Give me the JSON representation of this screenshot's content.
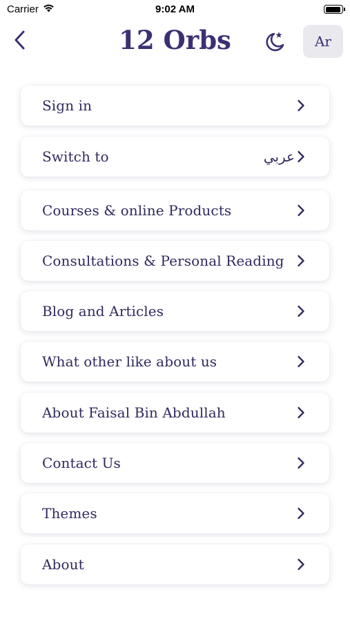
{
  "status_bar": {
    "carrier": "Carrier",
    "time": "9:02 AM",
    "battery_level": 0.95
  },
  "header": {
    "title": "12 Orbs",
    "back_icon": "chevron-left-icon",
    "theme_icon": "moon-star-icon",
    "language_button": "Ar"
  },
  "menu": {
    "items": [
      {
        "label": "Sign in",
        "value": ""
      },
      {
        "label": "Switch to",
        "value": "عربي"
      },
      {
        "label": "Courses & online Products",
        "value": ""
      },
      {
        "label": "Consultations & Personal Reading",
        "value": ""
      },
      {
        "label": "Blog and Articles",
        "value": ""
      },
      {
        "label": "What other like about us",
        "value": ""
      },
      {
        "label": "About Faisal Bin Abdullah",
        "value": ""
      },
      {
        "label": "Contact Us",
        "value": ""
      },
      {
        "label": "Themes",
        "value": ""
      },
      {
        "label": "About",
        "value": ""
      }
    ]
  },
  "colors": {
    "accent": "#3d2f73",
    "text": "#2f2a5e",
    "card": "#ffffff",
    "language_button_bg": "#e9e9ee"
  }
}
